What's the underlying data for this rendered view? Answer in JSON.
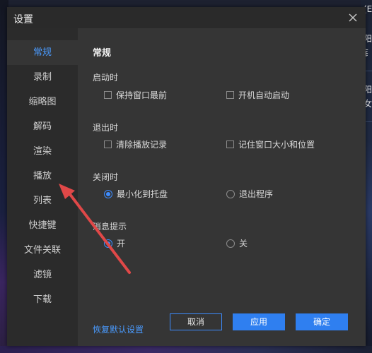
{
  "window": {
    "title": "设置"
  },
  "sidebar": {
    "items": [
      {
        "label": "常规",
        "active": true
      },
      {
        "label": "录制"
      },
      {
        "label": "缩略图"
      },
      {
        "label": "解码"
      },
      {
        "label": "渲染"
      },
      {
        "label": "播放"
      },
      {
        "label": "列表"
      },
      {
        "label": "快捷键"
      },
      {
        "label": "文件关联"
      },
      {
        "label": "滤镜"
      },
      {
        "label": "下载"
      }
    ]
  },
  "main": {
    "heading": "常规",
    "startup": {
      "label": "启动时",
      "keep_on_top": {
        "label": "保持窗口最前",
        "checked": false
      },
      "autostart": {
        "label": "开机自动启动",
        "checked": false
      }
    },
    "exit": {
      "label": "退出时",
      "clear_history": {
        "label": "清除播放记录",
        "checked": false
      },
      "remember_window": {
        "label": "记住窗口大小和位置",
        "checked": false
      }
    },
    "close": {
      "label": "关闭时",
      "minimize_tray": {
        "label": "最小化到托盘",
        "selected": true
      },
      "exit_program": {
        "label": "退出程序",
        "selected": false
      }
    },
    "notify": {
      "label": "消息提示",
      "on": {
        "label": "开",
        "selected": true
      },
      "off": {
        "label": "关",
        "selected": false
      }
    }
  },
  "footer": {
    "restore_label": "恢复默认设置",
    "cancel_label": "取消",
    "apply_label": "应用",
    "ok_label": "确定"
  },
  "background": {
    "right_text": [
      "(E",
      "阳",
      "钅",
      "阳",
      "女"
    ]
  },
  "colors": {
    "accent": "#3d8cff",
    "dialog_bg": "#353535",
    "sidebar_bg": "#2b2b2b",
    "titlebar_bg": "#2a2a2a",
    "annotation_arrow": "#e04848"
  }
}
